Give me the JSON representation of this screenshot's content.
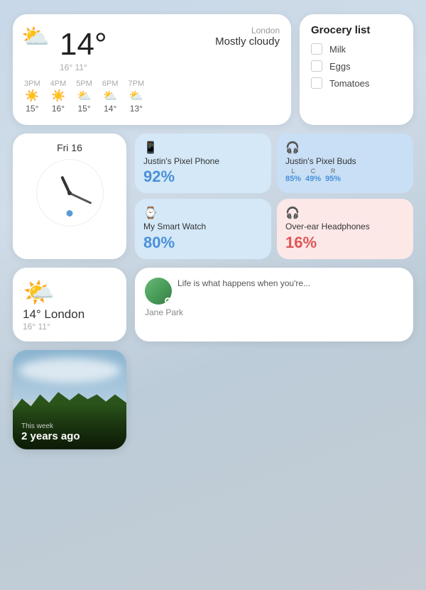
{
  "weather": {
    "city": "London",
    "condition": "Mostly cloudy",
    "temp": "14°",
    "range": "16° 11°",
    "forecast": [
      {
        "time": "3PM",
        "temp": "15°",
        "icon": "☀️"
      },
      {
        "time": "4PM",
        "temp": "16°",
        "icon": "☀️"
      },
      {
        "time": "5PM",
        "temp": "15°",
        "icon": "🌤️"
      },
      {
        "time": "6PM",
        "temp": "14°",
        "icon": "🌤️"
      },
      {
        "time": "7PM",
        "temp": "13°",
        "icon": "🌤️"
      }
    ],
    "mini": {
      "temp": "14° London",
      "range": "16° 11°"
    }
  },
  "grocery": {
    "title": "Grocery list",
    "items": [
      "Milk",
      "Eggs",
      "Tomatoes"
    ]
  },
  "clock": {
    "date": "Fri 16"
  },
  "devices": [
    {
      "name": "Justin's Pixel Phone",
      "pct": "92%",
      "icon": "📱",
      "color": "blue"
    },
    {
      "name": "Justin's Pixel Buds",
      "pct": null,
      "icon": "🎧",
      "color": "blue-dark",
      "levels": [
        {
          "label": "L",
          "val": "85%"
        },
        {
          "label": "C",
          "val": "49%"
        },
        {
          "label": "R",
          "val": "95%"
        }
      ]
    },
    {
      "name": "My Smart Watch",
      "pct": "80%",
      "icon": "⌚",
      "color": "blue"
    },
    {
      "name": "Over-ear Headphones",
      "pct": "16%",
      "icon": "🎧",
      "color": "pink"
    }
  ],
  "social": {
    "name": "Jane Park",
    "text": "Life is what happens when you're...",
    "online": true
  },
  "photo": {
    "label": "This week",
    "ago": "2 years ago"
  }
}
